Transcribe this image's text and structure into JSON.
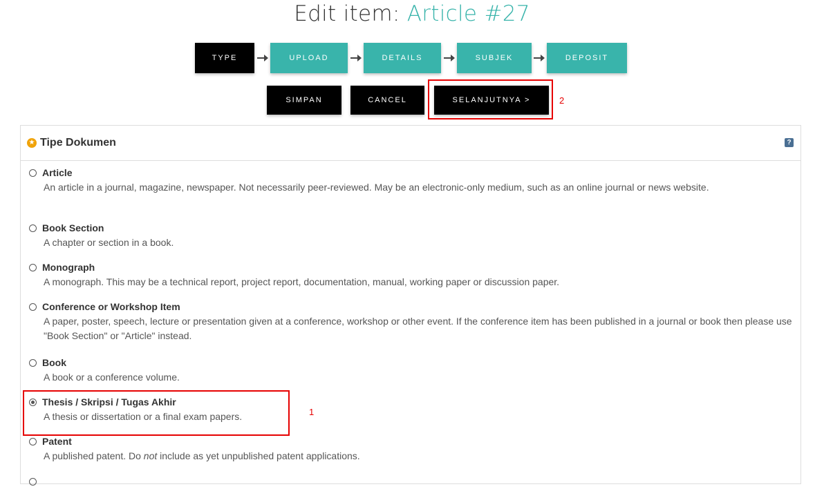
{
  "header": {
    "title_prefix": "Edit item: ",
    "title_accent": "Article #27"
  },
  "steps": [
    {
      "label": "TYPE",
      "state": "active"
    },
    {
      "label": "UPLOAD",
      "state": "todo"
    },
    {
      "label": "DETAILS",
      "state": "todo"
    },
    {
      "label": "SUBJEK",
      "state": "todo"
    },
    {
      "label": "DEPOSIT",
      "state": "todo"
    }
  ],
  "actions": {
    "save": "SIMPAN",
    "cancel": "CANCEL",
    "next": "SELANJUTNYA >"
  },
  "annotations": {
    "next_marker": "2",
    "selected_marker": "1",
    "color": "#e60000"
  },
  "panel": {
    "title": "Tipe Dokumen",
    "icon": "star-icon",
    "help_icon": "?",
    "options": [
      {
        "label": "Article",
        "desc": "An article in a journal, magazine, newspaper. Not necessarily peer-reviewed. May be an electronic-only medium, such as an online journal or news website.",
        "checked": false
      },
      {
        "label": "Book Section",
        "desc": "A chapter or section in a book.",
        "checked": false
      },
      {
        "label": "Monograph",
        "desc": "A monograph. This may be a technical report, project report, documentation, manual, working paper or discussion paper.",
        "checked": false
      },
      {
        "label": "Conference or Workshop Item",
        "desc": "A paper, poster, speech, lecture or presentation given at a conference, workshop or other event. If the conference item has been published in a journal or book then please use \"Book Section\" or \"Article\" instead.",
        "checked": false
      },
      {
        "label": "Book",
        "desc": "A book or a conference volume.",
        "checked": false
      },
      {
        "label": "Thesis / Skripsi / Tugas Akhir",
        "desc": "A thesis or dissertation or a final exam papers.",
        "checked": true
      },
      {
        "label": "Patent",
        "desc_pre": "A published patent. Do ",
        "desc_em": "not",
        "desc_post": " include as yet unpublished patent applications.",
        "checked": false
      }
    ]
  },
  "colors": {
    "accent": "#39b4ab",
    "active_step": "#000000",
    "button": "#000000"
  }
}
